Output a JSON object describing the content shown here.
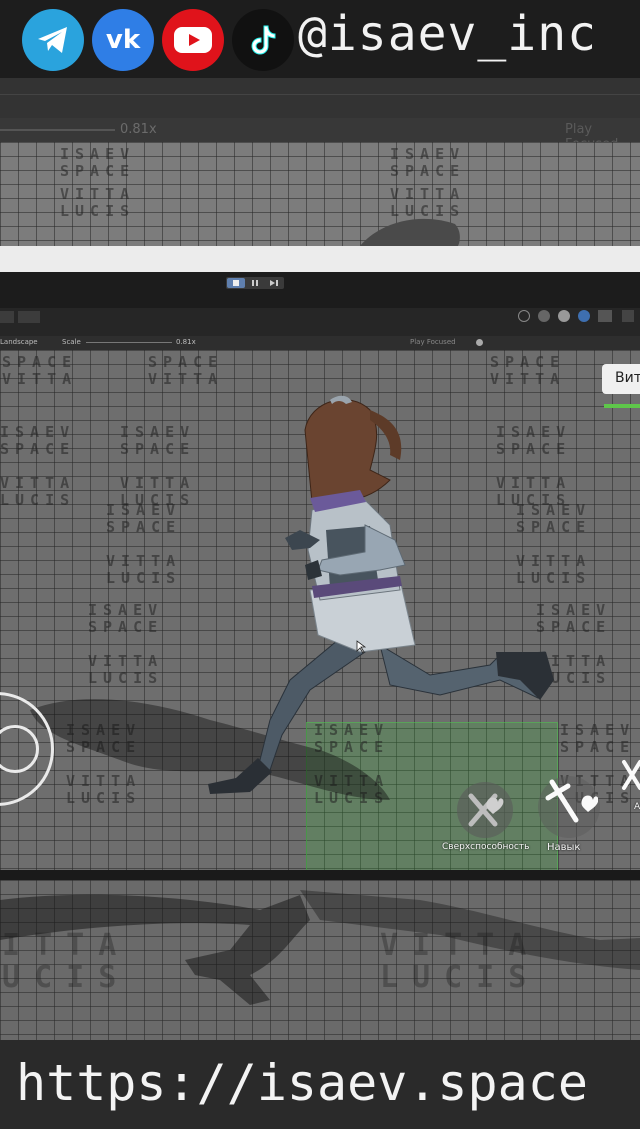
{
  "header": {
    "handle": "@isaev_inc",
    "socials": [
      {
        "name": "telegram",
        "color": "#2aa3dd",
        "icon": "telegram-icon"
      },
      {
        "name": "vk",
        "color": "#2f7ee6",
        "icon": "vk-icon"
      },
      {
        "name": "youtube",
        "color": "#e0131b",
        "icon": "youtube-icon"
      },
      {
        "name": "tiktok",
        "color": "#111111",
        "icon": "tiktok-icon"
      }
    ]
  },
  "upper": {
    "scale_value": "0.81x",
    "play_mode": "Play Focused"
  },
  "toolbar": {
    "orientation": "Landscape",
    "scale_label": "Scale",
    "scale_value": "0.81x",
    "play_mode": "Play Focused"
  },
  "floor_text": {
    "line1": "ISAEV",
    "line2": "SPACE",
    "line3": "VITTA",
    "line4": "LUCIS"
  },
  "hud": {
    "name_label": "Вит",
    "superpower_label": "Сверхспособность",
    "skill_label": "Навык",
    "extra_label": "А"
  },
  "footer": {
    "url": "https://isaev.space"
  },
  "colors": {
    "green_bar": "#5ec64a",
    "background": "#2b2b2b"
  }
}
